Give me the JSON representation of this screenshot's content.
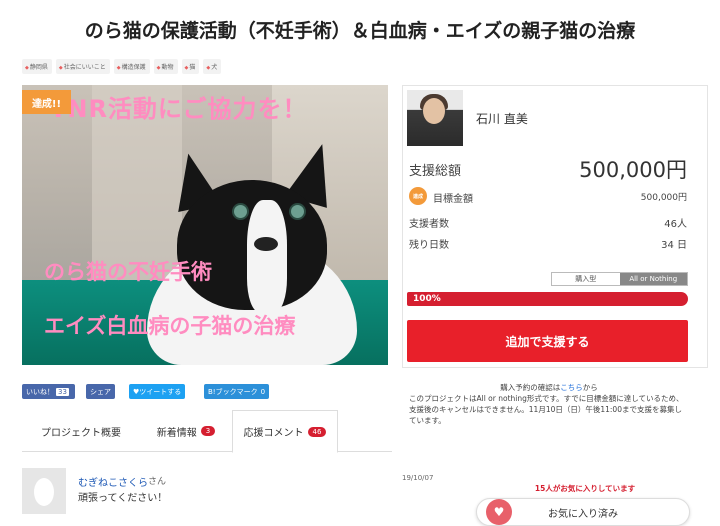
{
  "project": {
    "title": "のら猫の保護活動（不妊手術）＆白血病・エイズの親子猫の治療",
    "tags": [
      "静岡県",
      "社会にいいこと",
      "構造保護",
      "動物",
      "猫",
      "犬"
    ]
  },
  "hero": {
    "badge": "達成!!",
    "heading": "TNR活動にご協力を！",
    "line1": "のら猫の不妊手術",
    "line2": "エイズ白血病の子猫の治療"
  },
  "owner": {
    "name": "石川 直美"
  },
  "stats": {
    "total_label": "支援総額",
    "total_value": "500,000円",
    "goal_icon": "達成",
    "goal_label": "目標金額",
    "goal_value": "500,000円",
    "supporters_label": "支援者数",
    "supporters_value": "46人",
    "days_label": "残り日数",
    "days_value": "34 日"
  },
  "funding_type": {
    "option_a": "購入型",
    "option_b": "All or Nothing"
  },
  "progress": {
    "label": "100%",
    "percent": 100
  },
  "support_button": "追加で支援する",
  "social": {
    "like_label": "いいね！",
    "like_count": "33",
    "share_label": "シェア",
    "tweet_label": "ツイートする",
    "hatena_label": "B!ブックマーク",
    "hatena_count": "0"
  },
  "note": {
    "line1_prefix": "購入予約の確認は",
    "line1_link": "こちら",
    "line1_suffix": "から",
    "body": "このプロジェクトはAll or nothing形式です。すでに目標金額に達しているため、支援後のキャンセルはできません。11月10日（日）午後11:00まで支援を募集しています。"
  },
  "tabs": [
    {
      "label": "プロジェクト概要"
    },
    {
      "label": "新着情報",
      "count": "3"
    },
    {
      "label": "応援コメント",
      "count": "46"
    }
  ],
  "comment": {
    "name": "むぎねこさくら",
    "suffix": "さん",
    "text": "頑張ってください！",
    "date": "19/10/07"
  },
  "favorite": {
    "count_text": "15人がお気に入りしています",
    "button_label": "お気に入り済み"
  },
  "colors": {
    "accent": "#e8202a",
    "orange": "#f39a3a",
    "link": "#1a6ad8"
  }
}
